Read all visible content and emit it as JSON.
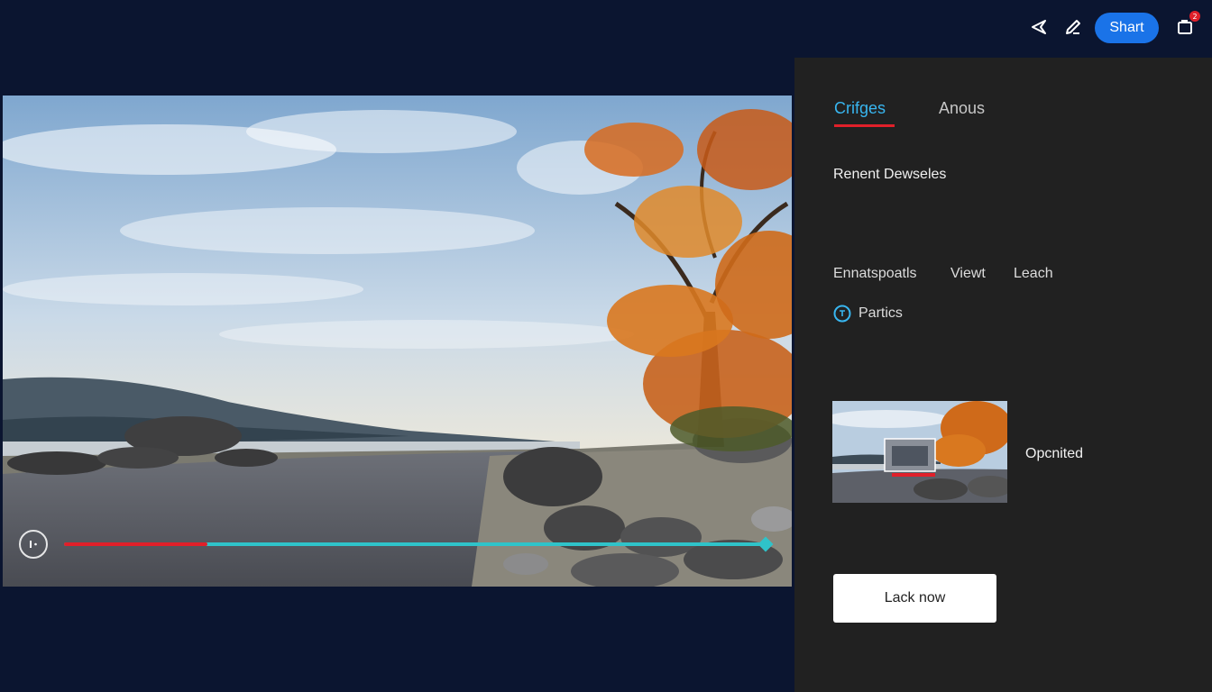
{
  "toolbar": {
    "icons": [
      "send-icon",
      "edit-icon",
      "notification-icon"
    ],
    "share_label": "Shart",
    "notification_count": "2"
  },
  "player": {
    "progress": 0.204,
    "colors": {
      "played": "#e0202a",
      "track": "#2fc3c9"
    }
  },
  "panel": {
    "tabs": [
      {
        "label": "Crifges",
        "active": true
      },
      {
        "label": "Anous",
        "active": false
      }
    ],
    "heading": "Renent Dewseles",
    "subtabs": [
      "Ennatspoatls",
      "Viewt",
      "Leach"
    ],
    "option": {
      "label": "Partics",
      "icon": "clock-icon"
    },
    "thumbnail": {
      "label": "Opcnited"
    },
    "action_button": "Lack now"
  },
  "colors": {
    "background": "#0b1530",
    "panel": "#212121",
    "accent": "#1a73e8",
    "active_tab": "#38b6f0",
    "underline": "#e0202a"
  }
}
